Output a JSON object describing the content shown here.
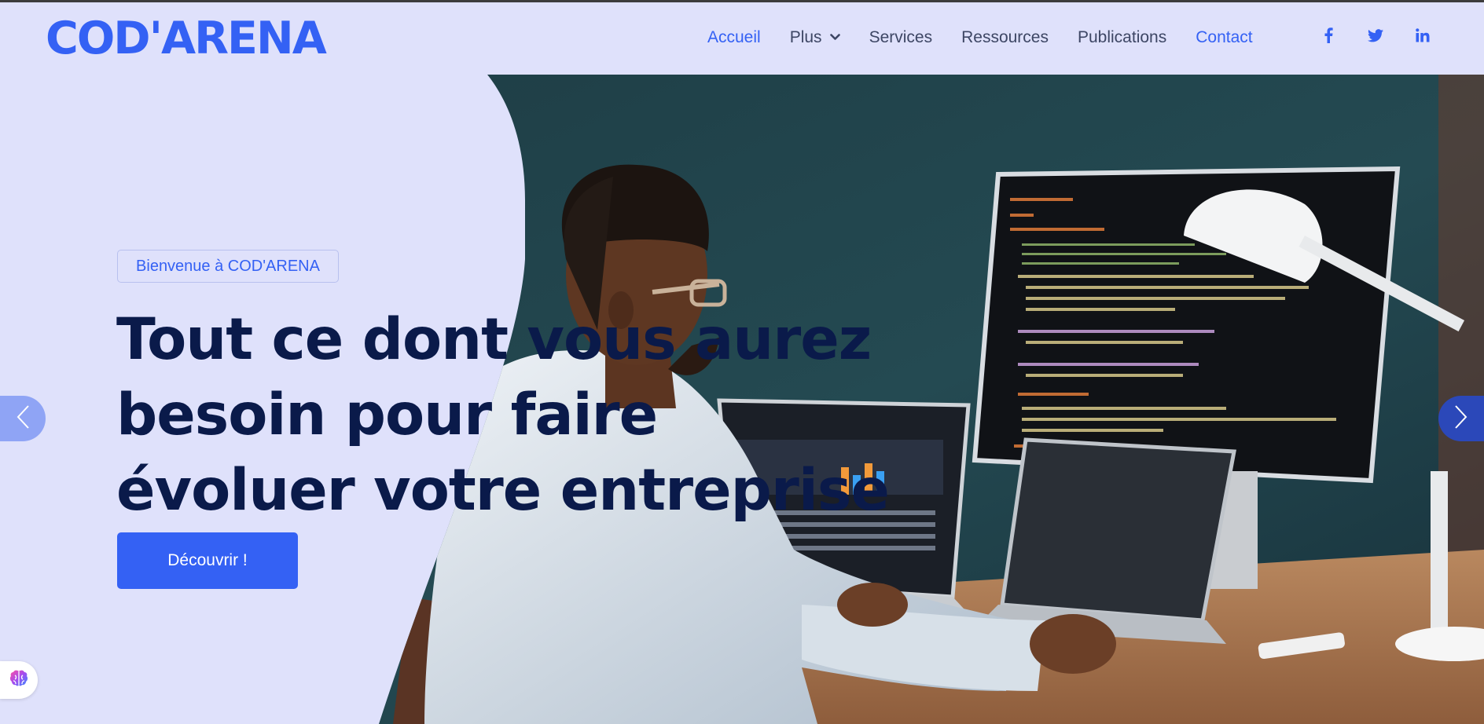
{
  "brand": {
    "logo_text": "COD'ARENA"
  },
  "nav": {
    "items": [
      {
        "label": "Accueil",
        "state": "active"
      },
      {
        "label": "Plus",
        "has_dropdown": true
      },
      {
        "label": "Services"
      },
      {
        "label": "Ressources"
      },
      {
        "label": "Publications"
      },
      {
        "label": "Contact",
        "state": "accent"
      }
    ]
  },
  "social": {
    "links": [
      {
        "icon": "facebook-icon"
      },
      {
        "icon": "twitter-icon"
      },
      {
        "icon": "linkedin-icon"
      }
    ]
  },
  "hero": {
    "badge": "Bienvenue à COD'ARENA",
    "headline_lines": [
      "Tout ce dont vous aurez",
      "besoin pour faire",
      "évoluer votre entreprise"
    ],
    "cta_label": "Découvrir !",
    "image_subject": "developer-working-at-desk-with-laptops-and-monitor",
    "prev_arrow_icon": "chevron-left-icon",
    "next_arrow_icon": "chevron-right-icon"
  },
  "widget": {
    "icon": "brain-icon"
  },
  "colors": {
    "background": "#dfe1fb",
    "accent": "#3461f4",
    "headline": "#0a1a4a",
    "nav_text": "#3d4664"
  }
}
